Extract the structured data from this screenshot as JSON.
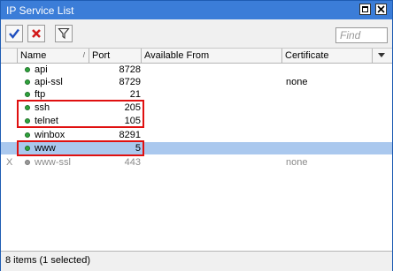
{
  "window": {
    "title": "IP Service List"
  },
  "toolbar": {
    "find_placeholder": "Find"
  },
  "columns": {
    "name": "Name",
    "port": "Port",
    "available_from": "Available From",
    "certificate": "Certificate"
  },
  "rows": [
    {
      "flag": "",
      "name": "api",
      "port": "8728",
      "available_from": "",
      "certificate": "",
      "disabled": false,
      "selected": false
    },
    {
      "flag": "",
      "name": "api-ssl",
      "port": "8729",
      "available_from": "",
      "certificate": "none",
      "disabled": false,
      "selected": false
    },
    {
      "flag": "",
      "name": "ftp",
      "port": "21",
      "available_from": "",
      "certificate": "",
      "disabled": false,
      "selected": false
    },
    {
      "flag": "",
      "name": "ssh",
      "port": "205",
      "available_from": "",
      "certificate": "",
      "disabled": false,
      "selected": false
    },
    {
      "flag": "",
      "name": "telnet",
      "port": "105",
      "available_from": "",
      "certificate": "",
      "disabled": false,
      "selected": false
    },
    {
      "flag": "",
      "name": "winbox",
      "port": "8291",
      "available_from": "",
      "certificate": "",
      "disabled": false,
      "selected": false
    },
    {
      "flag": "",
      "name": "www",
      "port": "5",
      "available_from": "",
      "certificate": "",
      "disabled": false,
      "selected": true
    },
    {
      "flag": "X",
      "name": "www-ssl",
      "port": "443",
      "available_from": "",
      "certificate": "none",
      "disabled": true,
      "selected": false
    }
  ],
  "status": {
    "text": "8 items (1 selected)"
  },
  "colors": {
    "titlebar": "#3b7dd8",
    "selection": "#aac8ee",
    "highlight_box": "#e01010",
    "enabled_dot": "#2fa33c",
    "disabled_text": "#8a8a8a"
  }
}
